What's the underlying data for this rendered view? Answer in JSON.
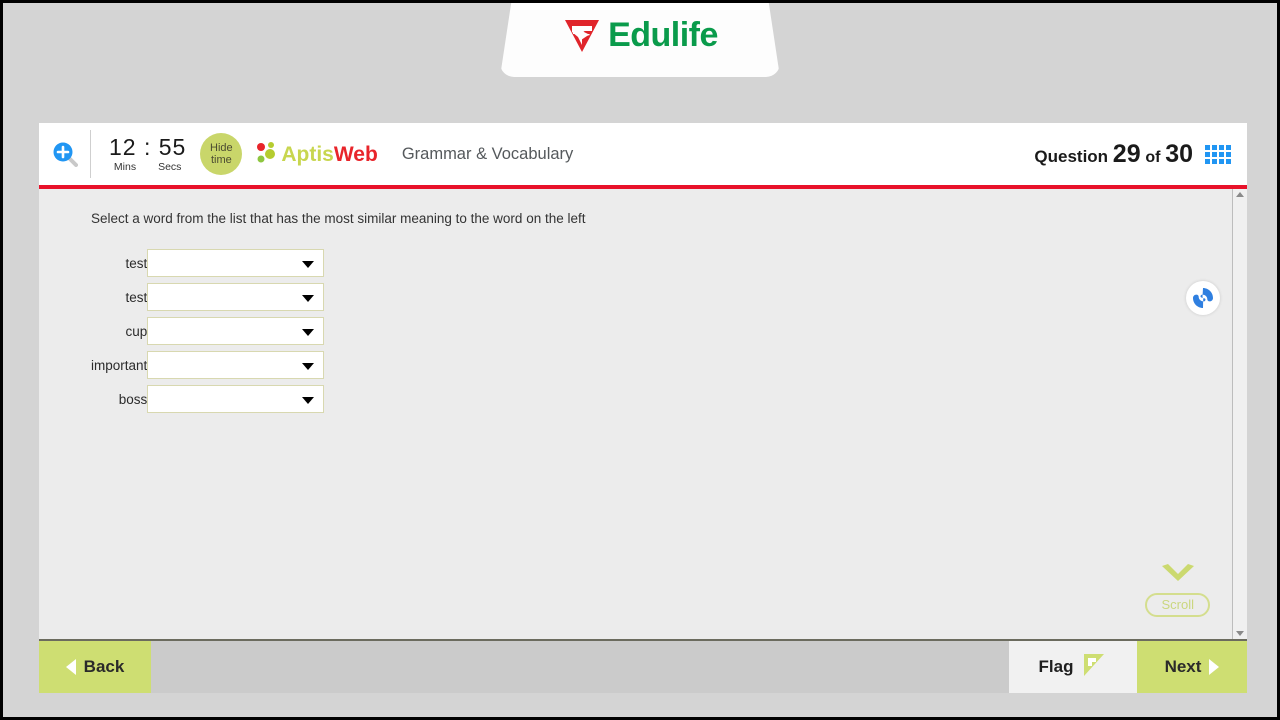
{
  "brand": {
    "name": "Edulife",
    "logo_icon": "edulife-triangle-logo"
  },
  "exam_header": {
    "zoom_icon": "magnifier-plus-icon",
    "timer": {
      "minutes": "12",
      "separator": ":",
      "seconds": "55",
      "minutes_label": "Mins",
      "seconds_label": "Secs"
    },
    "hide_time": {
      "line1": "Hide",
      "line2": "time"
    },
    "product_logo": {
      "part1": "Aptis",
      "part2": "Web",
      "dots_icon": "aptis-dots-icon"
    },
    "section_title": "Grammar & Vocabulary",
    "question_counter": {
      "prefix": "Question",
      "current": "29",
      "middle": "of",
      "total": "30"
    },
    "grid_icon": "question-grid-icon",
    "accent_color": "#e8122a"
  },
  "content": {
    "instruction": "Select a word from the list that has the most similar meaning to the word on the left",
    "rows": [
      {
        "word": "test",
        "value": "",
        "placeholder": ""
      },
      {
        "word": "test",
        "value": "",
        "placeholder": ""
      },
      {
        "word": "cup",
        "value": "",
        "placeholder": ""
      },
      {
        "word": "important",
        "value": "",
        "placeholder": ""
      },
      {
        "word": "boss",
        "value": "",
        "placeholder": ""
      }
    ],
    "helper_icon": "blue-spiral-icon",
    "scroll_hint": {
      "label": "Scroll",
      "icon": "chevron-down-icon"
    },
    "scrollbar": {
      "up_icon": "scroll-up-arrow-icon",
      "down_icon": "scroll-down-arrow-icon"
    }
  },
  "footer": {
    "back_label": "Back",
    "back_icon": "triangle-left-icon",
    "flag_label": "Flag",
    "flag_icon": "flag-icon",
    "next_label": "Next",
    "next_icon": "triangle-right-icon"
  },
  "colors": {
    "lime": "#cede72",
    "red": "#e8122a",
    "green": "#0a9b4b",
    "blue": "#2196f3"
  }
}
